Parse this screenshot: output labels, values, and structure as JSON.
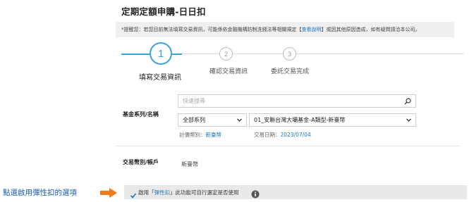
{
  "page": {
    "title": "定期定額申購-日日扣",
    "notice": {
      "prefix": "*提醒您：若您目前無法填寫交易資訊，可能係依金融機構防制洗錢法等相關規定【",
      "link": "查看說明",
      "suffix": "】或因其他原因造成，如有疑問請洽本公司。"
    }
  },
  "steps": [
    {
      "number": "1",
      "label": "填寫交易資訊",
      "active": true
    },
    {
      "number": "2",
      "label": "確認交易資訊",
      "active": false
    },
    {
      "number": "3",
      "label": "委託交易完成",
      "active": false
    }
  ],
  "fund": {
    "label": "基金系列/名稱",
    "search_placeholder": "快速搜尋",
    "series_value": "全部系列",
    "fund_value": "01_安聯台灣大壩基金-A類型-新臺幣",
    "currency_label": "計價幣別：",
    "currency_value": "新臺幣",
    "date_label": "交易日期：",
    "date_value": "2023/07/04"
  },
  "trade": {
    "label": "交易幣別/帳戶",
    "value": "新臺幣"
  },
  "flex": {
    "prefix": "啟用「",
    "highlight": "彈性扣",
    "suffix": "」此功能可自行選定是否使用",
    "checked": true
  },
  "annotation": {
    "text": "點選啟用彈性扣的選項"
  },
  "colors": {
    "accent": "#3aa6d8",
    "link": "#1a78c2",
    "arrow": "#f07a1a"
  },
  "icons": [
    "search-icon",
    "chevron-down-icon",
    "check-icon",
    "info-icon",
    "arrow-right-icon"
  ]
}
